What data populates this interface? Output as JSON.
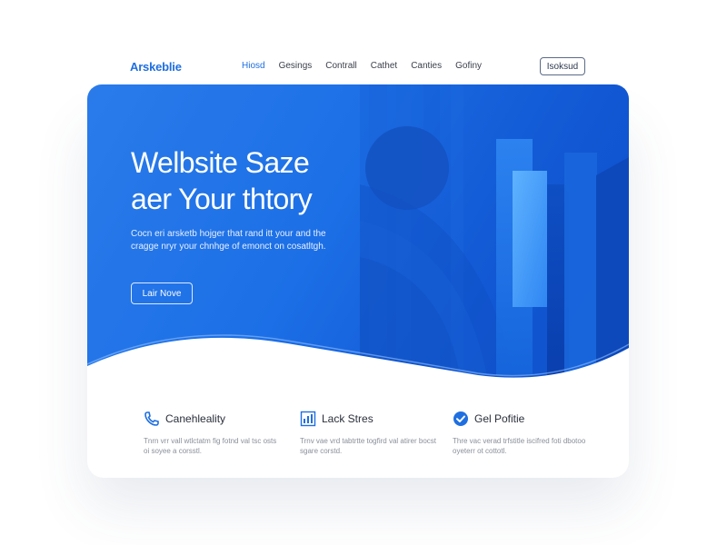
{
  "nav": {
    "brand": "Arskeblie",
    "items": [
      "Hiosd",
      "Gesings",
      "Contrall",
      "Cathet",
      "Canties",
      "Gofiny"
    ],
    "active_index": 0,
    "button_label": "Isoksud"
  },
  "hero": {
    "title_line1": "Welbsite Saze",
    "title_line2": "aer Your thtory",
    "description": "Cocn eri arsketb hojger that rand itt your and the cragge nryr your chnhge of emonct on cosatltgh.",
    "cta_label": "Lair Nove"
  },
  "features": [
    {
      "icon": "phone-icon",
      "title": "Canehleality",
      "desc": "Tnrn vrr vall wtlctatm fig fotnd val tsc osts oi soyee a corsstl."
    },
    {
      "icon": "grid-chart-icon",
      "title": "Lack Stres",
      "desc": "Trnv vae vrd tabtrtte togfird val atirer bocst sgare corstd."
    },
    {
      "icon": "checkmark-icon",
      "title": "Gel Pofitie",
      "desc": "Thre vac verad trfstitle iscifred foti dbotoo oyeterr ot cottotl."
    }
  ],
  "colors": {
    "accent": "#1f6fe0",
    "hero_start": "#2a7bea",
    "hero_end": "#0f4fc8",
    "text_dark": "#2a2f3a",
    "text_muted": "#8a8f99"
  }
}
